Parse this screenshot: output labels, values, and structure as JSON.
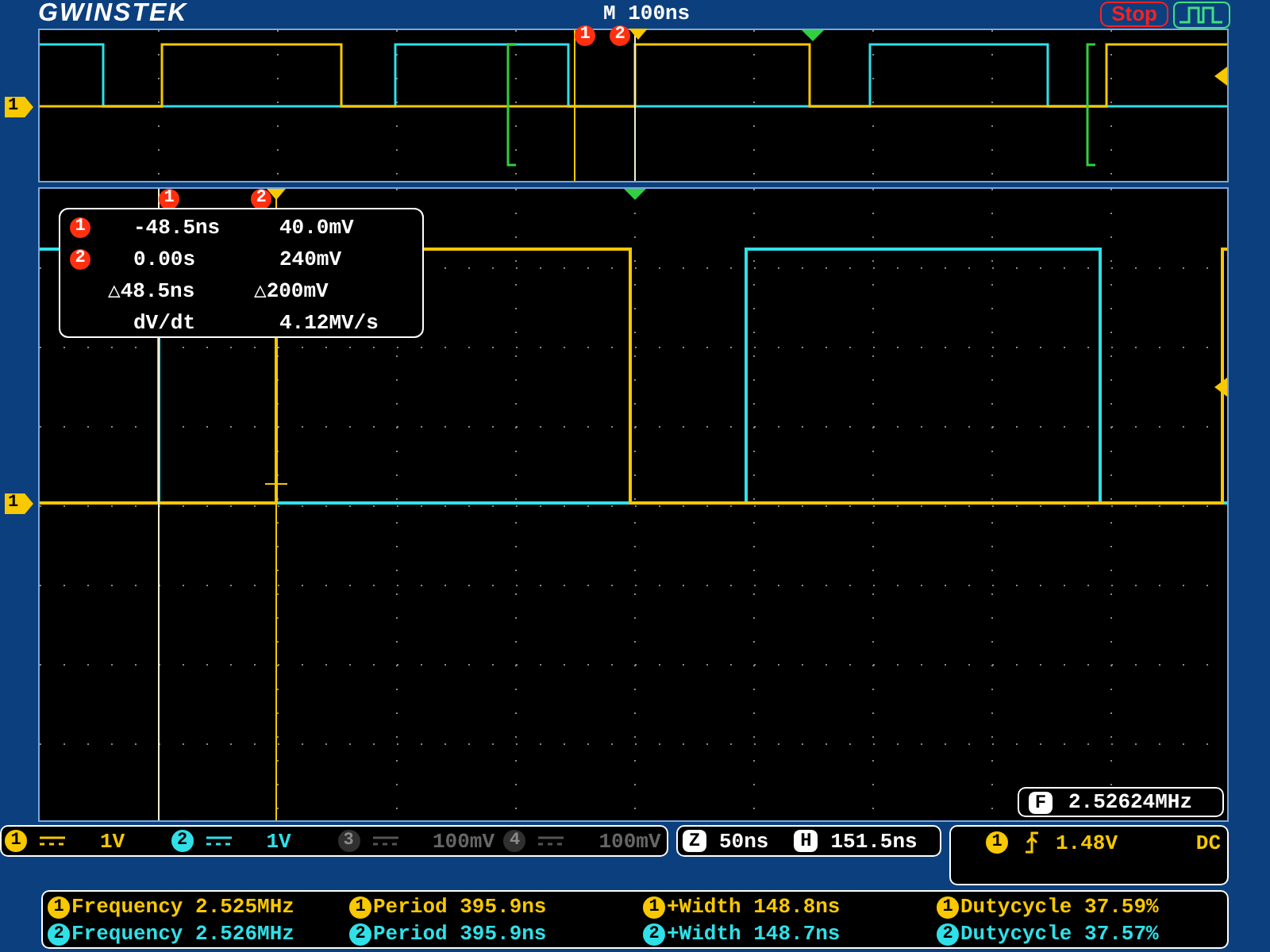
{
  "header": {
    "logo": "GWINSTEK",
    "timebase": "M 100ns",
    "run_state": "Stop"
  },
  "overview": {
    "cursor_labels": [
      "1",
      "2"
    ],
    "channel_marker": "1"
  },
  "main": {
    "cursor_labels": [
      "1",
      "2"
    ],
    "channel_marker": "1",
    "readout": [
      {
        "kind": "cursor",
        "marker": "1",
        "time": "-48.5ns",
        "value": "40.0mV"
      },
      {
        "kind": "cursor",
        "marker": "2",
        "time": "0.00s",
        "value": "240mV"
      },
      {
        "kind": "delta",
        "time": "△48.5ns",
        "value": "△200mV"
      },
      {
        "kind": "rate",
        "time": "dV/dt",
        "value": "4.12MV/s"
      }
    ],
    "counter": {
      "icon": "F",
      "value": "2.52624MHz"
    }
  },
  "channels": [
    {
      "number": "1",
      "scale": "1V",
      "enabled": true,
      "color": "#f8c800"
    },
    {
      "number": "2",
      "scale": "1V",
      "enabled": true,
      "color": "#30e0e8"
    },
    {
      "number": "3",
      "scale": "100mV",
      "enabled": false,
      "color": "#303030"
    },
    {
      "number": "4",
      "scale": "100mV",
      "enabled": false,
      "color": "#303030"
    }
  ],
  "horizontal": {
    "zoom_icon": "Z",
    "zoom_scale": "50ns",
    "position_icon": "H",
    "position": "151.5ns"
  },
  "trigger": {
    "source": "1",
    "level": "1.48V",
    "coupling": "DC"
  },
  "measurements": [
    {
      "color": "#f8c800",
      "items": [
        {
          "channel": "1",
          "text": "Frequency 2.525MHz"
        },
        {
          "channel": "1",
          "text": "Period 395.9ns"
        },
        {
          "channel": "1",
          "text": "+Width 148.8ns"
        },
        {
          "channel": "1",
          "text": "Dutycycle 37.59%"
        }
      ]
    },
    {
      "color": "#30e0e8",
      "items": [
        {
          "channel": "2",
          "text": "Frequency 2.526MHz"
        },
        {
          "channel": "2",
          "text": "Period 395.9ns"
        },
        {
          "channel": "2",
          "text": "+Width 148.7ns"
        },
        {
          "channel": "2",
          "text": "Dutycycle 37.57%"
        }
      ]
    }
  ]
}
